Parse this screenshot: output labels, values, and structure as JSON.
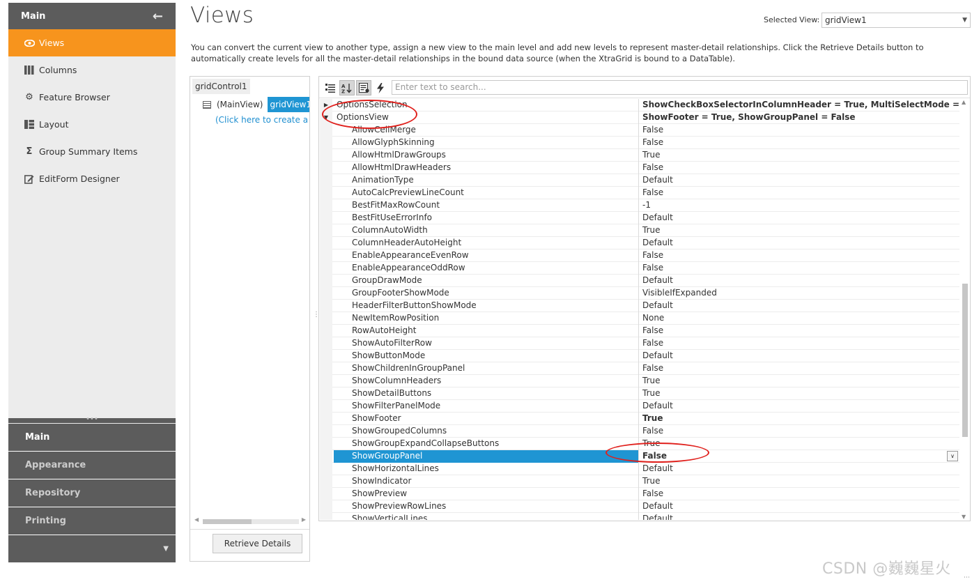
{
  "nav": {
    "header": "Main",
    "back_icon": "arrow-left-icon",
    "items": [
      {
        "label": "Views",
        "icon": "eye-icon",
        "active": true
      },
      {
        "label": "Columns",
        "icon": "columns-icon"
      },
      {
        "label": "Feature Browser",
        "icon": "gear-icon"
      },
      {
        "label": "Layout",
        "icon": "layout-icon"
      },
      {
        "label": "Group Summary Items",
        "icon": "sigma-icon"
      },
      {
        "label": "EditForm Designer",
        "icon": "edit-form-icon"
      }
    ],
    "groups": [
      "Main",
      "Appearance",
      "Repository",
      "Printing"
    ]
  },
  "header": {
    "title": "Views",
    "selected_view_label": "Selected View:",
    "selected_view_value": "gridView1",
    "description": "You can convert the current view to another type, assign a new view to the main level and add new levels to represent master-detail relationships. Click the Retrieve Details button to automatically create levels for all the master-detail relationships in the bound data source (when the XtraGrid is bound to a DataTable)."
  },
  "tree": {
    "root": "gridControl1",
    "main_view_label": "(MainView)",
    "main_view_value": "gridView1",
    "create_link": "(Click here to create a new level)",
    "retrieve_button": "Retrieve Details"
  },
  "property_grid": {
    "search_placeholder": "Enter text to search...",
    "toolbar_icons": [
      "categorized-icon",
      "alphabetical-sort-icon",
      "property-pages-icon",
      "events-lightning-icon"
    ],
    "rows": [
      {
        "name": "OptionsSelection",
        "value": "ShowCheckBoxSelectorInColumnHeader = True, MultiSelectMode = CheckBoxRowSelect",
        "type": "category",
        "expanded": false
      },
      {
        "name": "OptionsView",
        "value": "ShowFooter = True, ShowGroupPanel = False",
        "type": "category",
        "expanded": true
      },
      {
        "name": "AllowCellMerge",
        "value": "False"
      },
      {
        "name": "AllowGlyphSkinning",
        "value": "False"
      },
      {
        "name": "AllowHtmlDrawGroups",
        "value": "True"
      },
      {
        "name": "AllowHtmlDrawHeaders",
        "value": "False"
      },
      {
        "name": "AnimationType",
        "value": "Default"
      },
      {
        "name": "AutoCalcPreviewLineCount",
        "value": "False"
      },
      {
        "name": "BestFitMaxRowCount",
        "value": "-1"
      },
      {
        "name": "BestFitUseErrorInfo",
        "value": "Default"
      },
      {
        "name": "ColumnAutoWidth",
        "value": "True"
      },
      {
        "name": "ColumnHeaderAutoHeight",
        "value": "Default"
      },
      {
        "name": "EnableAppearanceEvenRow",
        "value": "False"
      },
      {
        "name": "EnableAppearanceOddRow",
        "value": "False"
      },
      {
        "name": "GroupDrawMode",
        "value": "Default"
      },
      {
        "name": "GroupFooterShowMode",
        "value": "VisibleIfExpanded"
      },
      {
        "name": "HeaderFilterButtonShowMode",
        "value": "Default"
      },
      {
        "name": "NewItemRowPosition",
        "value": "None"
      },
      {
        "name": "RowAutoHeight",
        "value": "False"
      },
      {
        "name": "ShowAutoFilterRow",
        "value": "False"
      },
      {
        "name": "ShowButtonMode",
        "value": "Default"
      },
      {
        "name": "ShowChildrenInGroupPanel",
        "value": "False"
      },
      {
        "name": "ShowColumnHeaders",
        "value": "True"
      },
      {
        "name": "ShowDetailButtons",
        "value": "True"
      },
      {
        "name": "ShowFilterPanelMode",
        "value": "Default"
      },
      {
        "name": "ShowFooter",
        "value": "True",
        "bold": true
      },
      {
        "name": "ShowGroupedColumns",
        "value": "False"
      },
      {
        "name": "ShowGroupExpandCollapseButtons",
        "value": "True"
      },
      {
        "name": "ShowGroupPanel",
        "value": "False",
        "selected": true
      },
      {
        "name": "ShowHorizontalLines",
        "value": "Default"
      },
      {
        "name": "ShowIndicator",
        "value": "True"
      },
      {
        "name": "ShowPreview",
        "value": "False"
      },
      {
        "name": "ShowPreviewRowLines",
        "value": "Default"
      },
      {
        "name": "ShowVerticalLines",
        "value": "Default"
      }
    ]
  },
  "watermark": "CSDN @巍巍星火",
  "colors": {
    "accent": "#f7941d",
    "selection": "#1f95d3",
    "nav_dark": "#5c5c5c",
    "annotation": "#e0201c"
  }
}
